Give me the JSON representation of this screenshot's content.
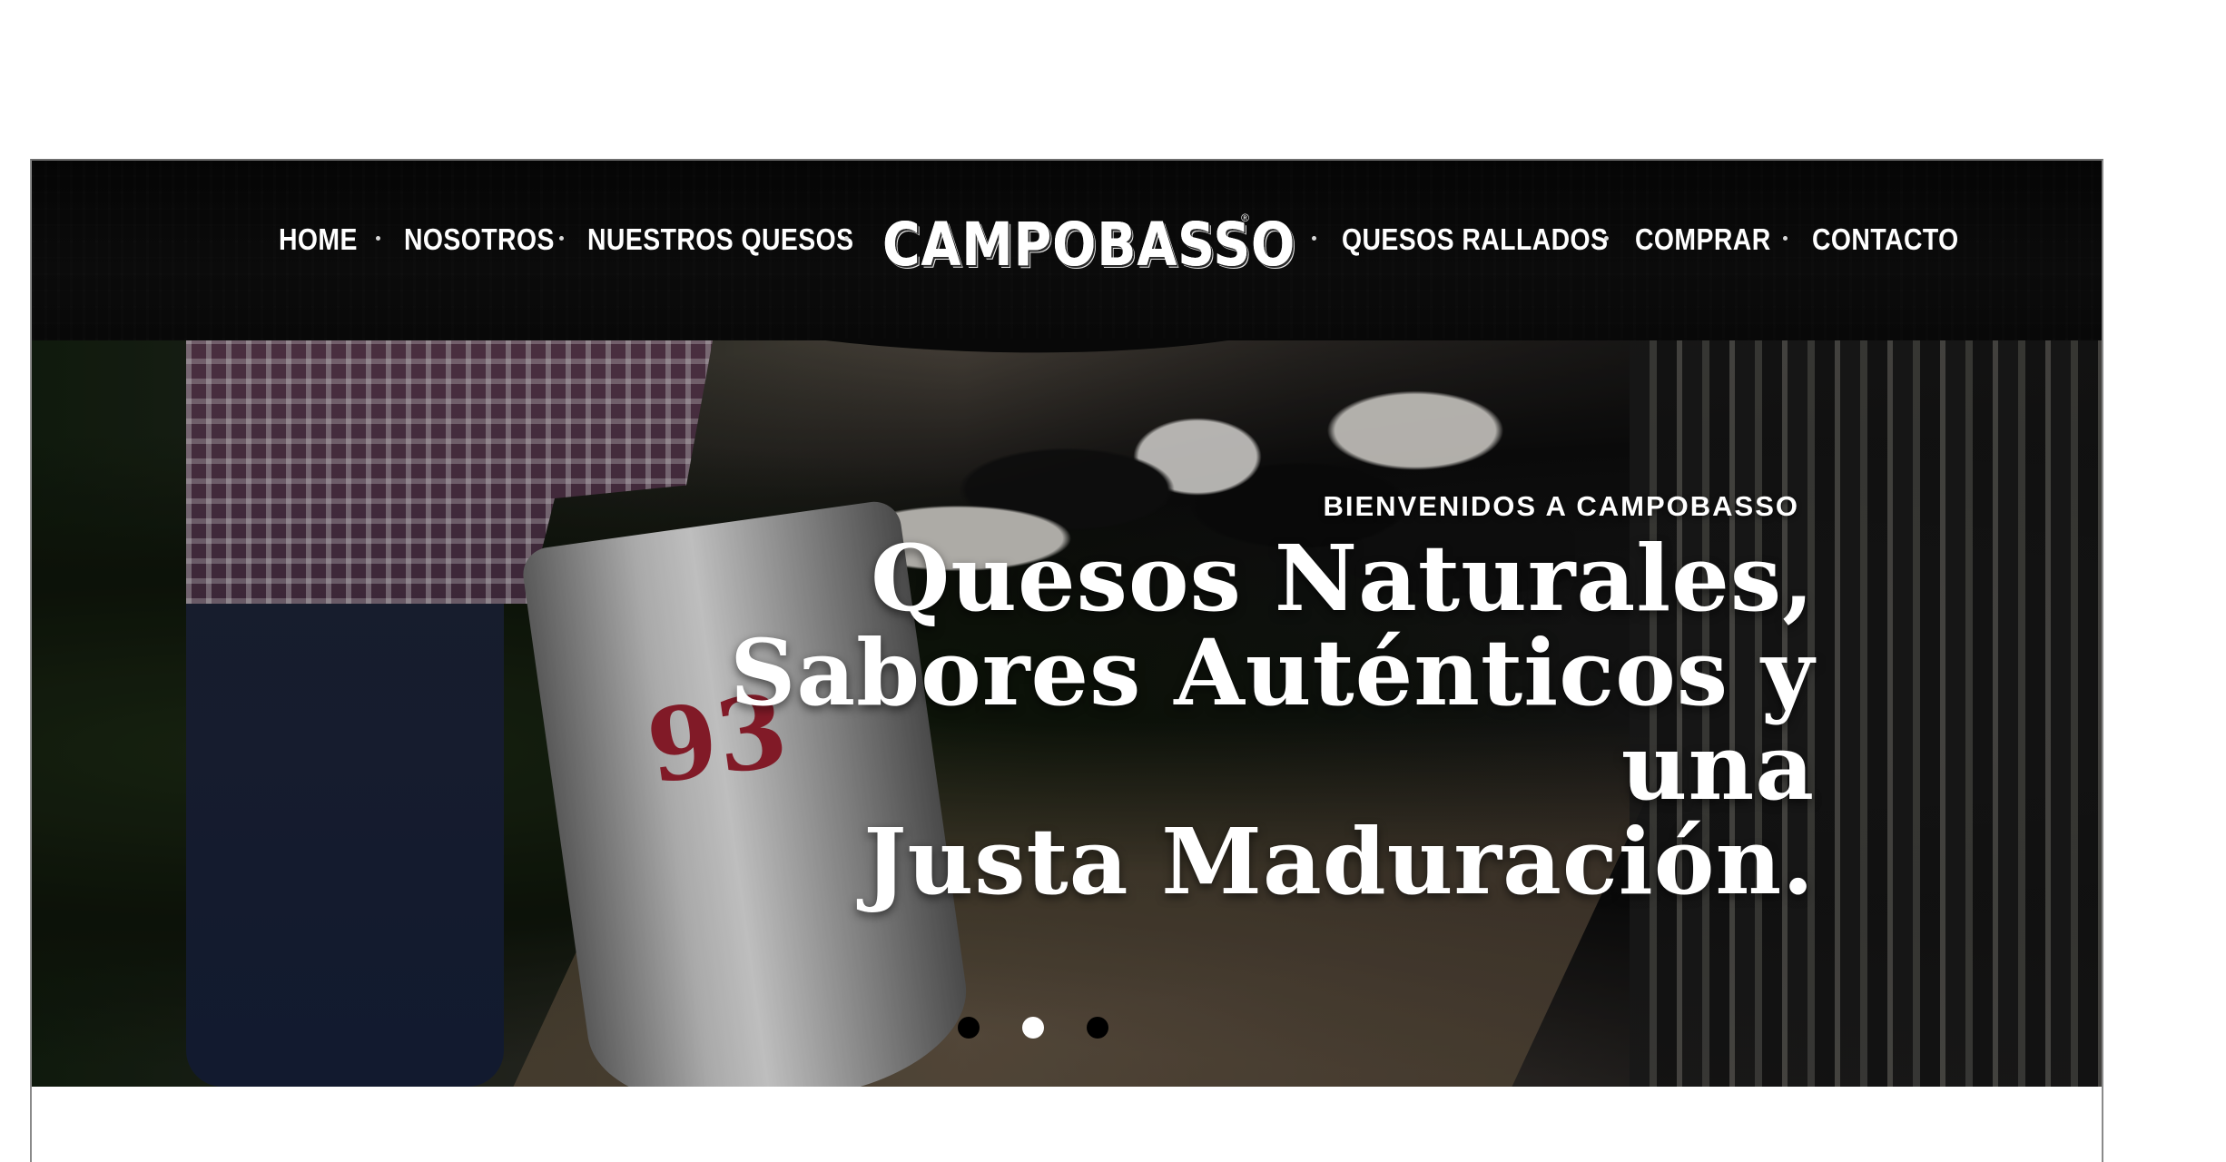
{
  "nav": {
    "left_items": [
      "HOME",
      "NOSOTROS",
      "NUESTROS QUESOS"
    ],
    "logo": "CAMPOBASSO",
    "logo_mark": "®",
    "right_items": [
      "QUESOS RALLADOS",
      "COMPRAR",
      "CONTACTO"
    ]
  },
  "hero": {
    "eyebrow": "BIENVENIDOS A CAMPOBASSO",
    "headline_lines": [
      "Quesos Naturales,",
      "Sabores Auténticos y una",
      "Justa Maduración."
    ],
    "can_number": "93",
    "slider": {
      "count": 3,
      "active_index": 1
    }
  },
  "colors": {
    "nav_background": "#070707",
    "text": "#ffffff",
    "dot_inactive": "#000000",
    "dot_active": "#ffffff"
  },
  "icons": [
    "separator-dot-icon",
    "registered-mark-icon"
  ]
}
